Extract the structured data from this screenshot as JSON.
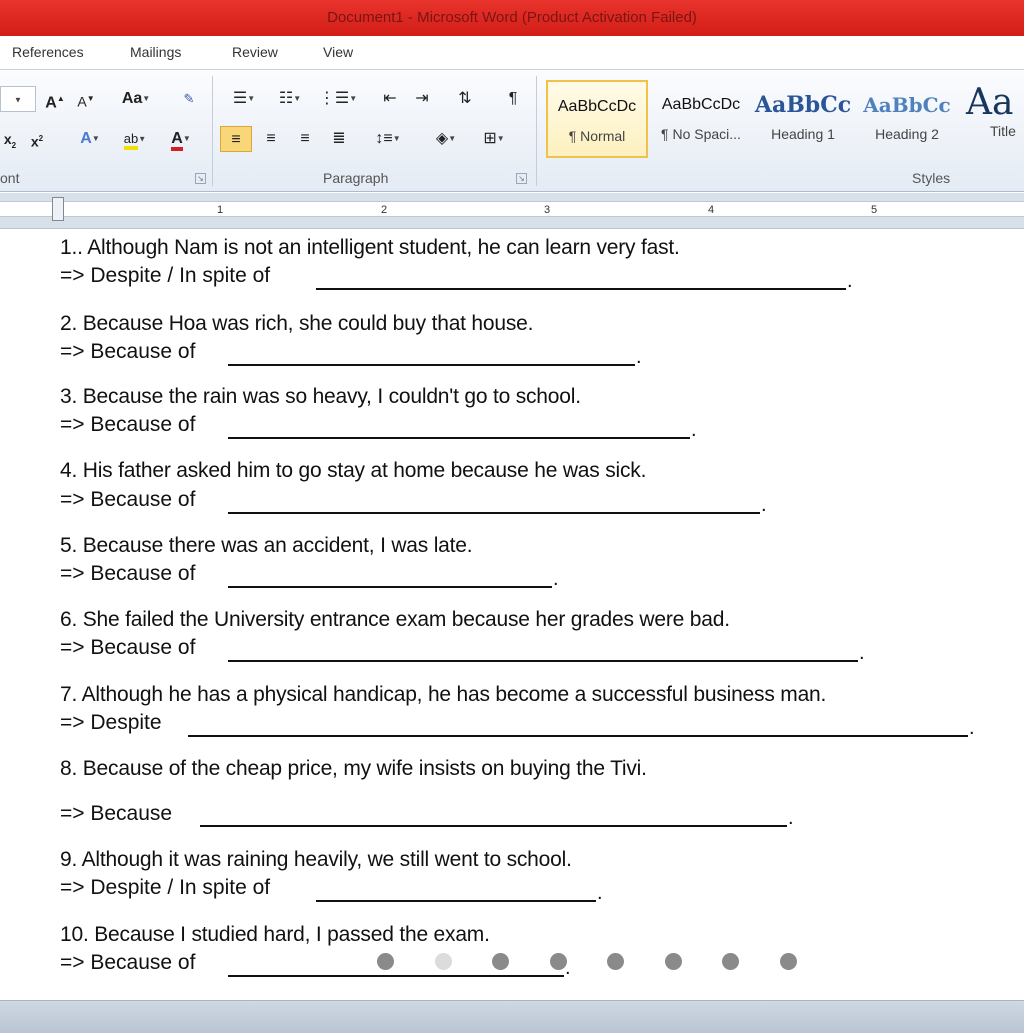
{
  "window": {
    "title": "Document1 - Microsoft Word (Product Activation Failed)"
  },
  "ribbon_tabs": [
    "References",
    "Mailings",
    "Review",
    "View"
  ],
  "ribbon": {
    "font_group_label": "ont",
    "paragraph_group_label": "Paragraph",
    "styles_group_label": "Styles",
    "font_buttons": {
      "grow": "A",
      "shrink": "A",
      "change_case": "Aa",
      "highlight": "ab",
      "font_color": "A",
      "subscript": "x",
      "superscript": "x"
    },
    "styles": [
      {
        "sample": "AaBbCcDc",
        "name": "¶ Normal"
      },
      {
        "sample": "AaBbCcDc",
        "name": "¶ No Spaci..."
      },
      {
        "sample": "AaBbCc",
        "name": "Heading 1"
      },
      {
        "sample": "AaBbCc",
        "name": "Heading 2"
      },
      {
        "sample": "Aa",
        "name": "Title"
      }
    ]
  },
  "ruler": {
    "numbers": [
      "1",
      "2",
      "3",
      "4",
      "5"
    ]
  },
  "document": {
    "items": [
      {
        "question": "1.. Although Nam is not an intelligent student, he can learn very fast.",
        "prompt": "=> Despite / In spite of"
      },
      {
        "question": "2. Because Hoa was rich, she could buy that house.",
        "prompt": "=> Because of"
      },
      {
        "question": "3. Because the rain was so heavy, I couldn't go to school.",
        "prompt": "=> Because of"
      },
      {
        "question": "4. His father asked him to go stay at home because he was sick.",
        "prompt": "=> Because of"
      },
      {
        "question": "5. Because there was an accident, I was late.",
        "prompt": "=> Because of"
      },
      {
        "question": "6. She failed the University entrance exam because her grades were bad.",
        "prompt": "=> Because of"
      },
      {
        "question": "7. Although he has a physical handicap, he has become a successful business man.",
        "prompt": "=> Despite"
      },
      {
        "question": "8. Because of the cheap price, my wife insists on buying the Tivi.",
        "prompt": "=> Because"
      },
      {
        "question": "9. Although it was raining heavily, we still went to school.",
        "prompt": "=> Despite / In spite of"
      },
      {
        "question": "10. Because I studied hard, I passed the exam.",
        "prompt": "=> Because of"
      }
    ],
    "terminator": "."
  },
  "carousel": {
    "count": 8,
    "active_index": 1
  }
}
